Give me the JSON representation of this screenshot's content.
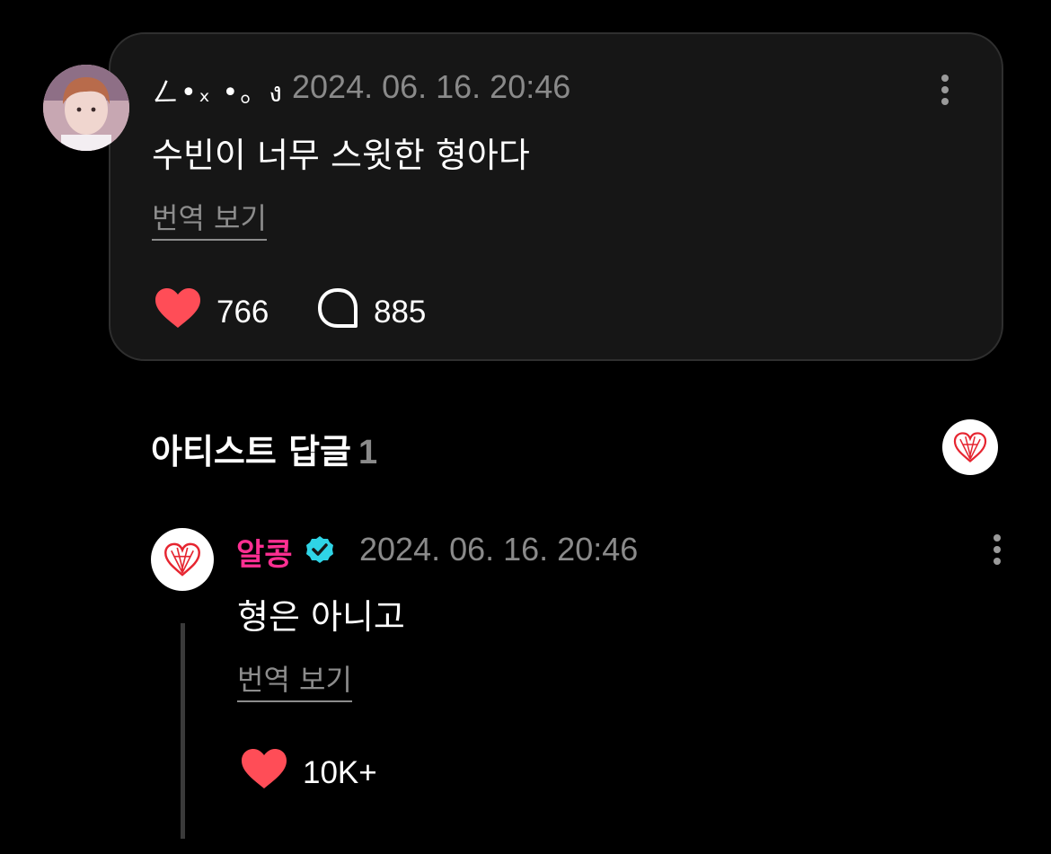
{
  "post": {
    "author_name": "ㄥ•ₓ •。ง",
    "timestamp": "2024. 06. 16. 20:46",
    "text": "수빈이 너무 스윗한 형아다",
    "translate_label": "번역 보기",
    "likes": "766",
    "comments": "885"
  },
  "artist_replies": {
    "title": "아티스트 답글",
    "count": "1"
  },
  "reply": {
    "author_name": "알콩",
    "timestamp": "2024. 06. 16. 20:46",
    "text": "형은 아니고",
    "translate_label": "번역 보기",
    "likes": "10K+"
  },
  "colors": {
    "background": "#000000",
    "card": "#161616",
    "heart": "#ff4d57",
    "artist_name": "#ff2f92",
    "verified_badge": "#2fd4e6",
    "muted_text": "#8a8a8a"
  },
  "icons": {
    "like": "heart-icon",
    "comment": "speech-bubble-icon",
    "more": "kebab-menu-icon",
    "verified": "verified-badge-icon",
    "artist_logo": "red-heart-logo"
  }
}
